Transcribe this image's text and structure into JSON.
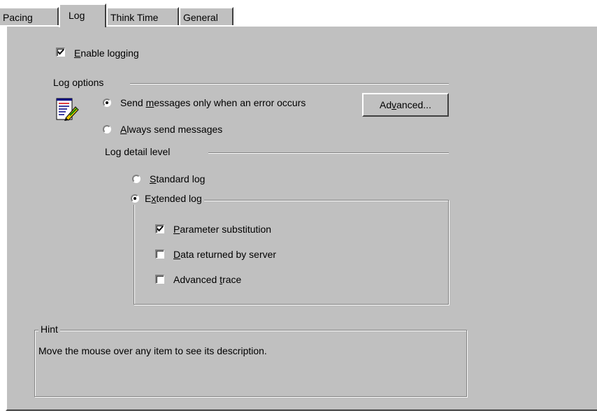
{
  "tabs": [
    {
      "label": "Pacing",
      "active": false
    },
    {
      "label": "Log",
      "active": true
    },
    {
      "label": "Think Time",
      "active": false
    },
    {
      "label": "General",
      "active": false
    }
  ],
  "enable_logging": {
    "label_pre": "",
    "label_accel": "E",
    "label_post": "nable logging",
    "checked": true
  },
  "log_options": {
    "title": "Log options",
    "icon": "log-notepad-pencil-icon",
    "send_on_error": {
      "pre": "Send ",
      "accel": "m",
      "post": "essages only when an error occurs",
      "selected": true
    },
    "always_send": {
      "pre": "",
      "accel": "A",
      "post": "lways send messages",
      "selected": false
    },
    "advanced_button": {
      "pre": "Ad",
      "accel": "v",
      "post": "anced..."
    }
  },
  "detail": {
    "title": "Log detail level",
    "standard": {
      "pre": "",
      "accel": "S",
      "post": "tandard log",
      "selected": false
    },
    "extended": {
      "pre": "E",
      "accel": "x",
      "post": "tended log",
      "selected": true
    },
    "options": [
      {
        "pre": "",
        "accel": "P",
        "post": "arameter substitution",
        "checked": true
      },
      {
        "pre": "",
        "accel": "D",
        "post": "ata returned by server",
        "checked": false
      },
      {
        "pre": "Advanced ",
        "accel": "t",
        "post": "race",
        "checked": false
      }
    ]
  },
  "hint": {
    "title": "Hint",
    "text": "Move the mouse over any item to see its description."
  }
}
